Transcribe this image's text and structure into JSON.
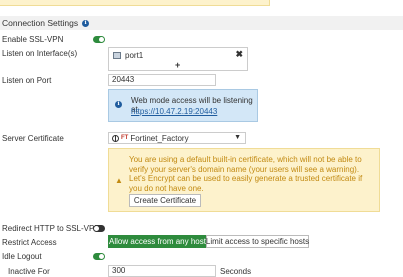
{
  "section": {
    "title": "Connection Settings",
    "info_icon": "i"
  },
  "fields": {
    "enable_ssl_vpn": {
      "label": "Enable SSL-VPN",
      "enabled": true
    },
    "listen_interfaces": {
      "label": "Listen on Interface(s)",
      "items": [
        "port1"
      ],
      "add_symbol": "+",
      "remove_symbol": "✖"
    },
    "listen_port": {
      "label": "Listen on Port",
      "value": "20443"
    },
    "web_mode_info": {
      "text": "Web mode access will be listening at",
      "link": "https://10.47.2.19:20443"
    },
    "server_certificate": {
      "label": "Server Certificate",
      "selected": "Fortinet_Factory",
      "warning": "You are using a default built-in certificate, which will not be able to verify your server's domain name (your users will see a warning). Let's Encrypt can be used to easily generate a trusted certificate if you do not have one.",
      "create_button": "Create Certificate"
    },
    "redirect_http": {
      "label": "Redirect HTTP to SSL-VPN",
      "enabled": false
    },
    "restrict_access": {
      "label": "Restrict Access",
      "options": [
        "Allow access from any host",
        "Limit access to specific hosts"
      ],
      "selected": 0
    },
    "idle_logout": {
      "label": "Idle Logout",
      "enabled": true
    },
    "inactive_for": {
      "label": "Inactive For",
      "value": "300",
      "unit": "Seconds"
    }
  },
  "colors": {
    "toggle_on": "#2e8b3d",
    "accent_blue": "#1f5c9e",
    "warning_text": "#c28a12",
    "warning_bg": "#fdf2cc",
    "info_bg": "#d3e7f7"
  },
  "icons": {
    "info": "info-icon",
    "port": "port-icon",
    "globe": "globe-icon",
    "warning": "warning-icon"
  }
}
